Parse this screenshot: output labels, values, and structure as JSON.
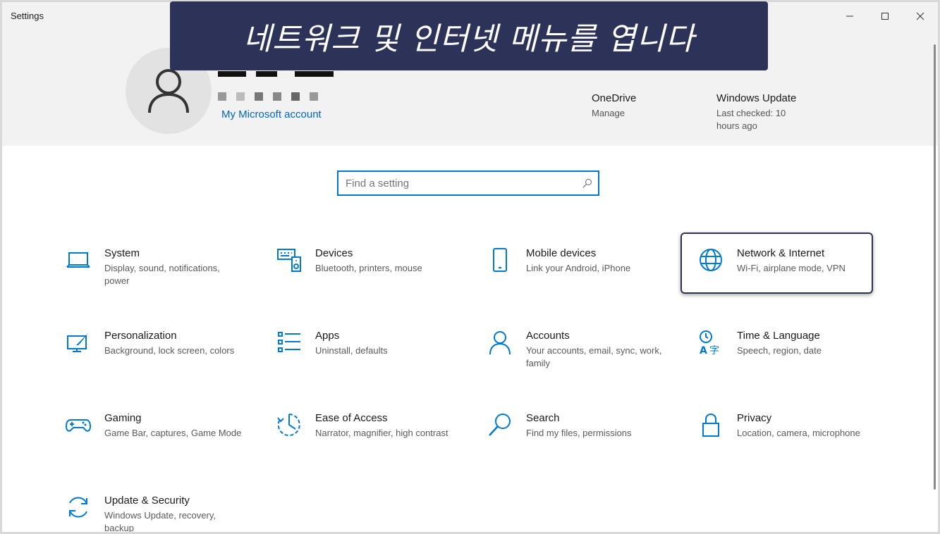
{
  "window": {
    "title": "Settings"
  },
  "banner": {
    "text": "네트워크 및 인터넷 메뉴를 엽니다"
  },
  "account": {
    "link": "My Microsoft account"
  },
  "quick_links": {
    "onedrive": {
      "title": "OneDrive",
      "sub": "Manage"
    },
    "update": {
      "title": "Windows Update",
      "sub": "Last checked: 10 hours ago"
    }
  },
  "search": {
    "placeholder": "Find a setting"
  },
  "categories": [
    {
      "title": "System",
      "desc": "Display, sound, notifications, power"
    },
    {
      "title": "Devices",
      "desc": "Bluetooth, printers, mouse"
    },
    {
      "title": "Mobile devices",
      "desc": "Link your Android, iPhone"
    },
    {
      "title": "Network & Internet",
      "desc": "Wi-Fi, airplane mode, VPN"
    },
    {
      "title": "Personalization",
      "desc": "Background, lock screen, colors"
    },
    {
      "title": "Apps",
      "desc": "Uninstall, defaults"
    },
    {
      "title": "Accounts",
      "desc": "Your accounts, email, sync, work, family"
    },
    {
      "title": "Time & Language",
      "desc": "Speech, region, date"
    },
    {
      "title": "Gaming",
      "desc": "Game Bar, captures, Game Mode"
    },
    {
      "title": "Ease of Access",
      "desc": "Narrator, magnifier, high contrast"
    },
    {
      "title": "Search",
      "desc": "Find my files, permissions"
    },
    {
      "title": "Privacy",
      "desc": "Location, camera, microphone"
    },
    {
      "title": "Update & Security",
      "desc": "Windows Update, recovery, backup"
    }
  ],
  "colors": {
    "accent": "#0078d4",
    "link": "#0067c0",
    "banner": "#2d3258"
  }
}
